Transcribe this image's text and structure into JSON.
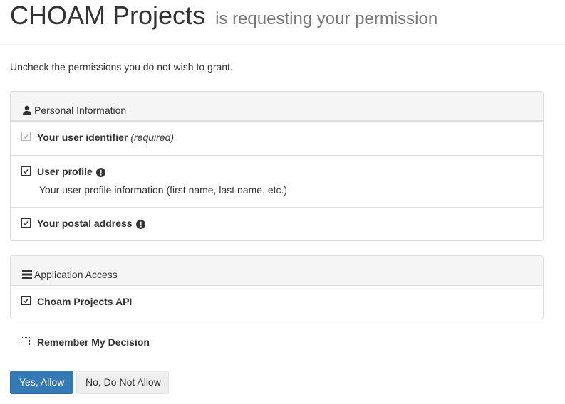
{
  "header": {
    "app_name": "CHOAM Projects",
    "subtitle": "is requesting your permission"
  },
  "intro": "Uncheck the permissions you do not wish to grant.",
  "panels": [
    {
      "heading": "Personal Information",
      "icon": "user-icon",
      "items": [
        {
          "label": "Your user identifier",
          "note": "(required)",
          "checked": true,
          "disabled": true
        },
        {
          "label": "User profile",
          "info_icon": "exclamation-sign-icon",
          "description": "Your user profile information (first name, last name, etc.)",
          "checked": true
        },
        {
          "label": "Your postal address",
          "info_icon": "exclamation-sign-icon",
          "checked": true
        }
      ]
    },
    {
      "heading": "Application Access",
      "icon": "tasks-icon",
      "items": [
        {
          "label": "Choam Projects API",
          "checked": true
        }
      ]
    }
  ],
  "remember": {
    "label": "Remember My Decision",
    "checked": false
  },
  "buttons": {
    "allow": "Yes, Allow",
    "deny": "No, Do Not Allow"
  },
  "colors": {
    "primary": "#337ab7",
    "panel_heading_bg": "#f5f5f5",
    "border": "#dddddd"
  }
}
